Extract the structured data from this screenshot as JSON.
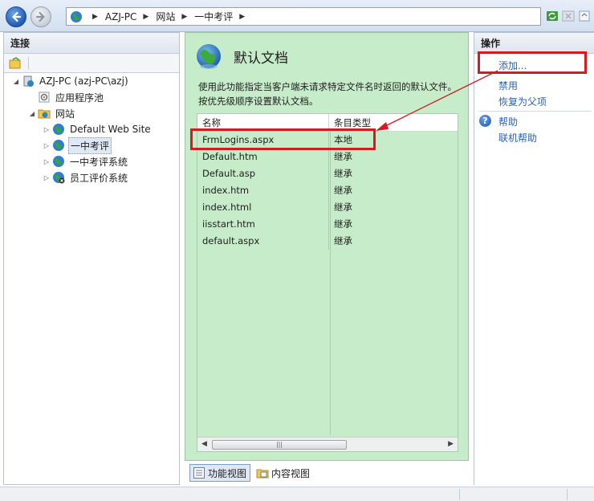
{
  "nav": {
    "breadcrumbs": [
      "AZJ-PC",
      "网站",
      "一中考评"
    ]
  },
  "connections": {
    "title": "连接",
    "tree": [
      {
        "label": "AZJ-PC (azj-PC\\azj)",
        "level": 0,
        "expander": "expanded",
        "icon": "server-icon"
      },
      {
        "label": "应用程序池",
        "level": 1,
        "expander": "none",
        "icon": "app-pool-icon"
      },
      {
        "label": "网站",
        "level": 1,
        "expander": "expanded",
        "icon": "sites-folder-icon"
      },
      {
        "label": "Default Web Site",
        "level": 2,
        "expander": "collapsed",
        "icon": "globe-icon"
      },
      {
        "label": "一中考评",
        "level": 2,
        "expander": "collapsed",
        "icon": "globe-icon",
        "selected": true
      },
      {
        "label": "一中考评系统",
        "level": 2,
        "expander": "collapsed",
        "icon": "globe-icon"
      },
      {
        "label": "员工评价系统",
        "level": 2,
        "expander": "collapsed",
        "icon": "globe-icon"
      }
    ]
  },
  "content": {
    "title": "默认文档",
    "description": "使用此功能指定当客户端未请求特定文件名时返回的默认文件。按优先级顺序设置默认文档。",
    "columns": [
      "名称",
      "条目类型"
    ],
    "rows": [
      {
        "name": "FrmLogins.aspx",
        "type": "本地"
      },
      {
        "name": "Default.htm",
        "type": "继承"
      },
      {
        "name": "Default.asp",
        "type": "继承"
      },
      {
        "name": "index.htm",
        "type": "继承"
      },
      {
        "name": "index.html",
        "type": "继承"
      },
      {
        "name": "iisstart.htm",
        "type": "继承"
      },
      {
        "name": "default.aspx",
        "type": "继承"
      }
    ]
  },
  "views": {
    "features": "功能视图",
    "content": "内容视图"
  },
  "actions": {
    "title": "操作",
    "add": "添加...",
    "disable": "禁用",
    "revert": "恢复为父项",
    "help": "帮助",
    "online_help": "联机帮助"
  },
  "colors": {
    "content_background": "#c6ecc9",
    "link": "#2a63b4",
    "annotation": "#d71920"
  }
}
